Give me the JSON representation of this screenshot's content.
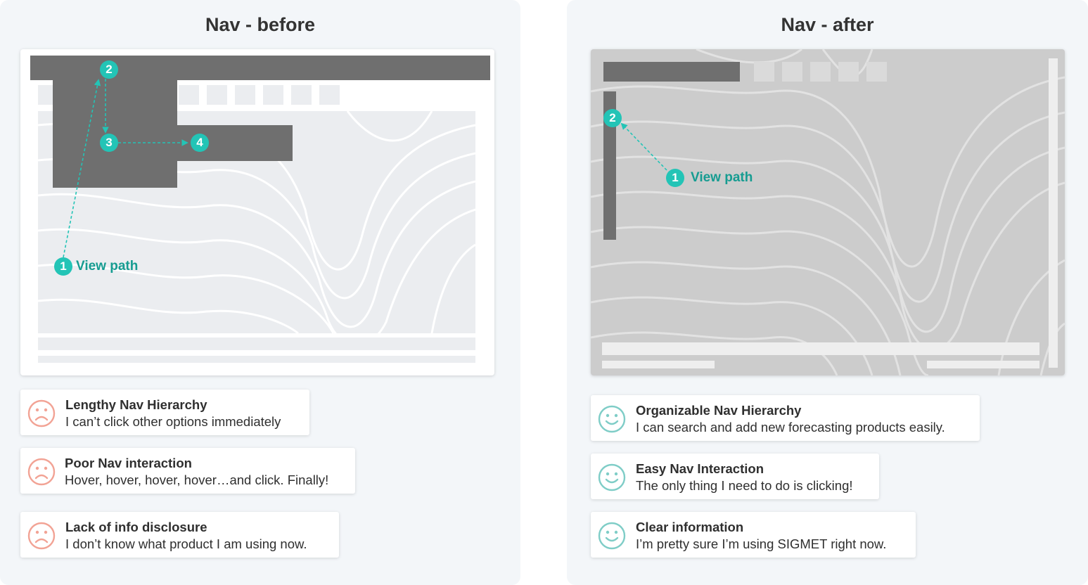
{
  "before": {
    "title": "Nav - before",
    "path_label": "View path",
    "steps": [
      "1",
      "2",
      "3",
      "4"
    ],
    "cards": [
      {
        "title": "Lengthy Nav Hierarchy",
        "desc": "I can’t click other options immediately",
        "icon": "sad-face-icon"
      },
      {
        "title": "Poor Nav interaction",
        "desc": "Hover, hover, hover, hover…and click. Finally!",
        "icon": "sad-face-icon"
      },
      {
        "title": "Lack of info disclosure",
        "desc": "I don’t know what product I am using now.",
        "icon": "sad-face-icon"
      }
    ]
  },
  "after": {
    "title": "Nav - after",
    "path_label": "View path",
    "steps": [
      "1",
      "2"
    ],
    "cards": [
      {
        "title": "Organizable Nav Hierarchy",
        "desc": "I can search and add new forecasting products easily.",
        "icon": "happy-face-icon"
      },
      {
        "title": "Easy Nav Interaction",
        "desc": "The only thing I need to do is clicking!",
        "icon": "happy-face-icon"
      },
      {
        "title": "Clear information",
        "desc": "I’m pretty sure I’m using SIGMET right now.",
        "icon": "happy-face-icon"
      }
    ]
  },
  "colors": {
    "accent": "#23c4b6",
    "accent_text": "#169c91",
    "sad": "#f2a395",
    "happy": "#7fcdc7",
    "nav_dark": "#6f6f6f",
    "panel_bg": "#f3f6f9"
  }
}
